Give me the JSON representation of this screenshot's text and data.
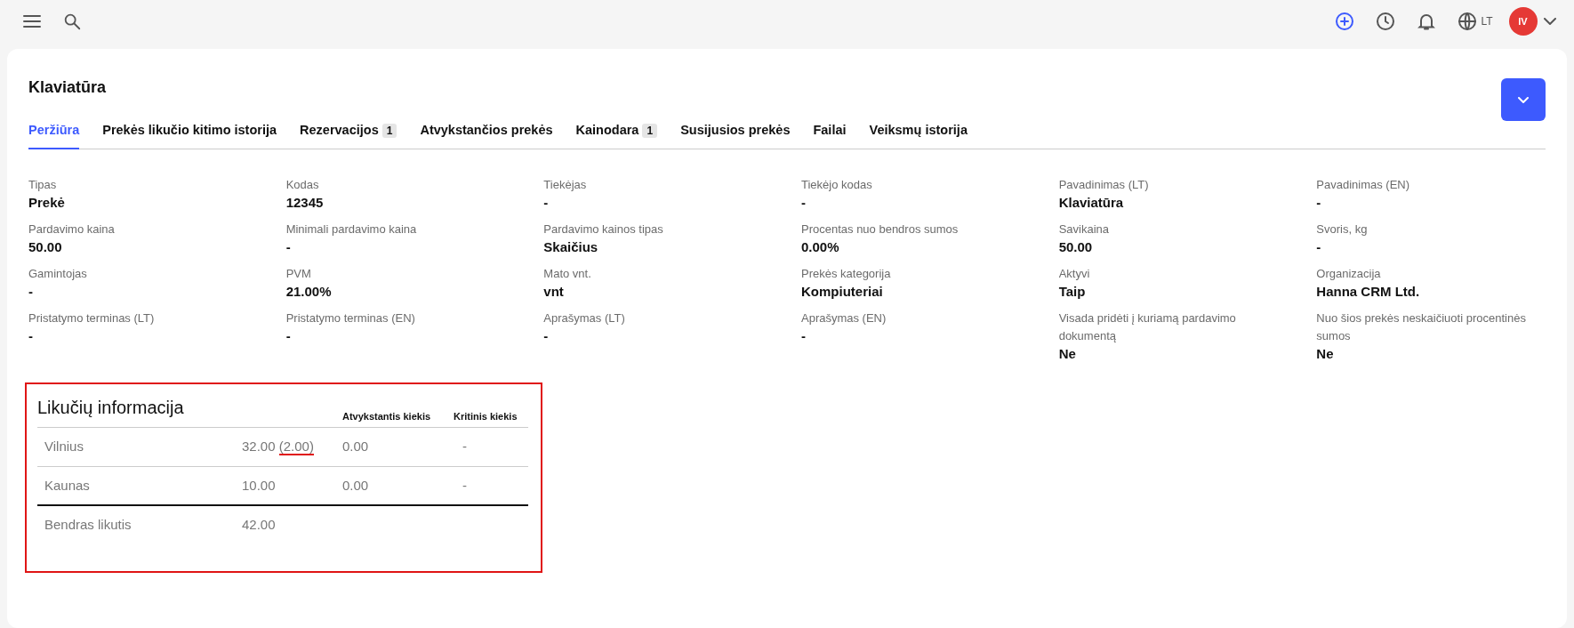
{
  "topbar": {
    "language": "LT",
    "avatar_initials": "IV"
  },
  "page": {
    "title": "Klaviatūra"
  },
  "tabs": [
    {
      "label": "Peržiūra",
      "selected": true
    },
    {
      "label": "Prekės likučio kitimo istorija",
      "selected": false
    },
    {
      "label": "Rezervacijos",
      "count": "1",
      "selected": false
    },
    {
      "label": "Atvykstančios prekės",
      "selected": false
    },
    {
      "label": "Kainodara",
      "count": "1",
      "selected": false
    },
    {
      "label": "Susijusios prekės",
      "selected": false
    },
    {
      "label": "Failai",
      "selected": false
    },
    {
      "label": "Veiksmų istorija",
      "selected": false
    }
  ],
  "fields": [
    {
      "label": "Tipas",
      "value": "Prekė"
    },
    {
      "label": "Kodas",
      "value": "12345"
    },
    {
      "label": "Tiekėjas",
      "value": "-"
    },
    {
      "label": "Tiekėjo kodas",
      "value": "-"
    },
    {
      "label": "Pavadinimas (LT)",
      "value": "Klaviatūra"
    },
    {
      "label": "Pavadinimas (EN)",
      "value": "-"
    },
    {
      "label": "Pardavimo kaina",
      "value": "50.00"
    },
    {
      "label": "Minimali pardavimo kaina",
      "value": "-"
    },
    {
      "label": "Pardavimo kainos tipas",
      "value": "Skaičius"
    },
    {
      "label": "Procentas nuo bendros sumos",
      "value": "0.00%"
    },
    {
      "label": "Savikaina",
      "value": "50.00"
    },
    {
      "label": "Svoris, kg",
      "value": "-"
    },
    {
      "label": "Gamintojas",
      "value": "-"
    },
    {
      "label": "PVM",
      "value": "21.00%"
    },
    {
      "label": "Mato vnt.",
      "value": "vnt"
    },
    {
      "label": "Prekės kategorija",
      "value": "Kompiuteriai"
    },
    {
      "label": "Aktyvi",
      "value": "Taip"
    },
    {
      "label": "Organizacija",
      "value": "Hanna CRM Ltd."
    },
    {
      "label": "Pristatymo terminas (LT)",
      "value": "-"
    },
    {
      "label": "Pristatymo terminas (EN)",
      "value": "-"
    },
    {
      "label": "Aprašymas (LT)",
      "value": "-"
    },
    {
      "label": "Aprašymas (EN)",
      "value": "-"
    },
    {
      "label": "Visada pridėti į kuriamą pardavimo dokumentą",
      "value": "Ne"
    },
    {
      "label": "Nuo šios prekės neskaičiuoti procentinės sumos",
      "value": "Ne"
    }
  ],
  "stock": {
    "title": "Likučių informacija",
    "highlighted": true,
    "columns": [
      "Atvykstantis kiekis",
      "Kritinis kiekis"
    ],
    "rows": [
      {
        "warehouse": "Vilnius",
        "quantity": "32.00",
        "reserved": "(2.00)",
        "reserved_highlighted": true,
        "incoming": "0.00",
        "critical": "-"
      },
      {
        "warehouse": "Kaunas",
        "quantity": "10.00",
        "incoming": "0.00",
        "critical": "-"
      }
    ],
    "total": {
      "label": "Bendras likutis",
      "quantity": "42.00"
    }
  }
}
